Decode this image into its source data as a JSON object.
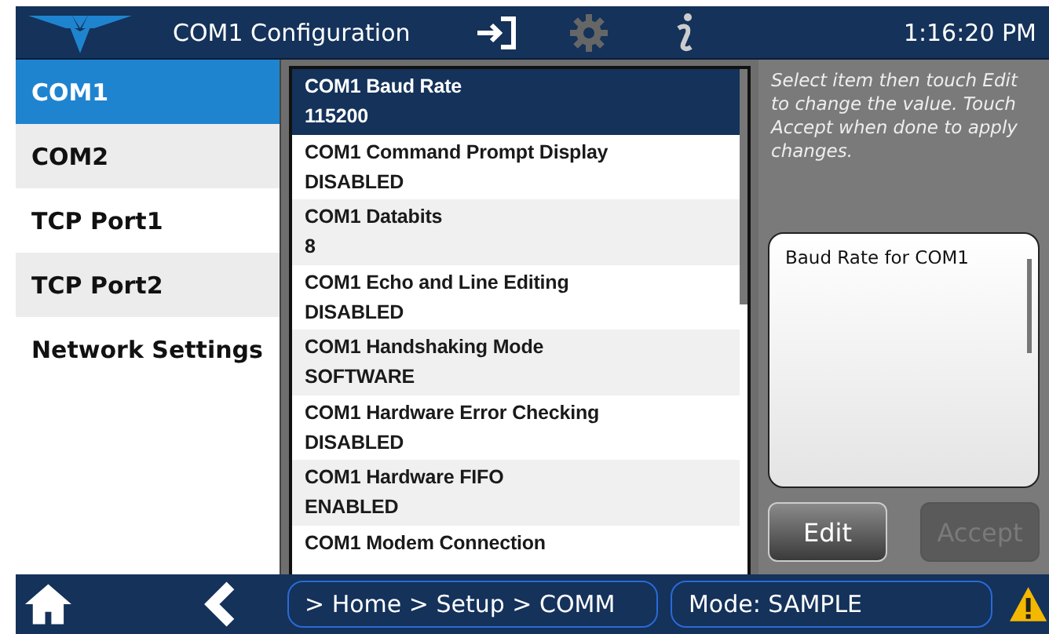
{
  "header": {
    "title": "COM1 Configuration",
    "time": "1:16:20 PM"
  },
  "sidebar": {
    "items": [
      {
        "label": "COM1",
        "selected": true
      },
      {
        "label": "COM2",
        "selected": false
      },
      {
        "label": "TCP Port1",
        "selected": false
      },
      {
        "label": "TCP Port2",
        "selected": false
      },
      {
        "label": "Network Settings",
        "selected": false
      }
    ]
  },
  "settings": [
    {
      "name": "COM1 Baud Rate",
      "value": "115200",
      "selected": true
    },
    {
      "name": "COM1 Command Prompt Display",
      "value": "DISABLED",
      "selected": false
    },
    {
      "name": "COM1 Databits",
      "value": "8",
      "selected": false
    },
    {
      "name": "COM1 Echo and Line Editing",
      "value": "DISABLED",
      "selected": false
    },
    {
      "name": "COM1 Handshaking Mode",
      "value": "SOFTWARE",
      "selected": false
    },
    {
      "name": "COM1 Hardware Error Checking",
      "value": "DISABLED",
      "selected": false
    },
    {
      "name": "COM1 Hardware FIFO",
      "value": "ENABLED",
      "selected": false
    },
    {
      "name": "COM1 Modem Connection",
      "selected": false
    }
  ],
  "help_text": "Select item then touch Edit to change the value. Touch Accept when done to apply changes.",
  "description": "Baud Rate for COM1",
  "buttons": [
    {
      "label": "Edit",
      "disabled": false
    },
    {
      "label": "Accept",
      "disabled": true
    }
  ],
  "footer": {
    "breadcrumb": "> Home > Setup > COMM",
    "mode": "Mode: SAMPLE"
  }
}
